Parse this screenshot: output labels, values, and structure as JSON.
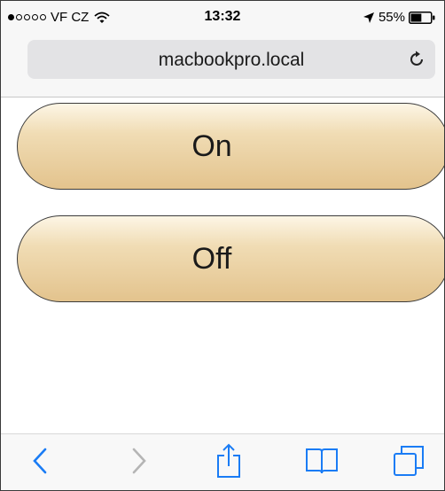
{
  "status_bar": {
    "carrier": "VF CZ",
    "signal_filled": 1,
    "signal_total": 5,
    "time": "13:32",
    "battery": "55%",
    "battery_level": 0.55
  },
  "address_bar": {
    "url": "macbookpro.local",
    "reload_icon": "reload-icon"
  },
  "buttons": {
    "on_label": "On",
    "off_label": "Off"
  },
  "toolbar": {
    "icons": [
      "back-icon",
      "forward-icon",
      "share-icon",
      "bookmarks-icon",
      "tabs-icon"
    ]
  },
  "colors": {
    "accent": "#1a7cf5",
    "disabled": "#b5b5b5",
    "button_top": "#fdf6e6",
    "button_bottom": "#e3c38d",
    "button_border": "#3b3b3b"
  }
}
